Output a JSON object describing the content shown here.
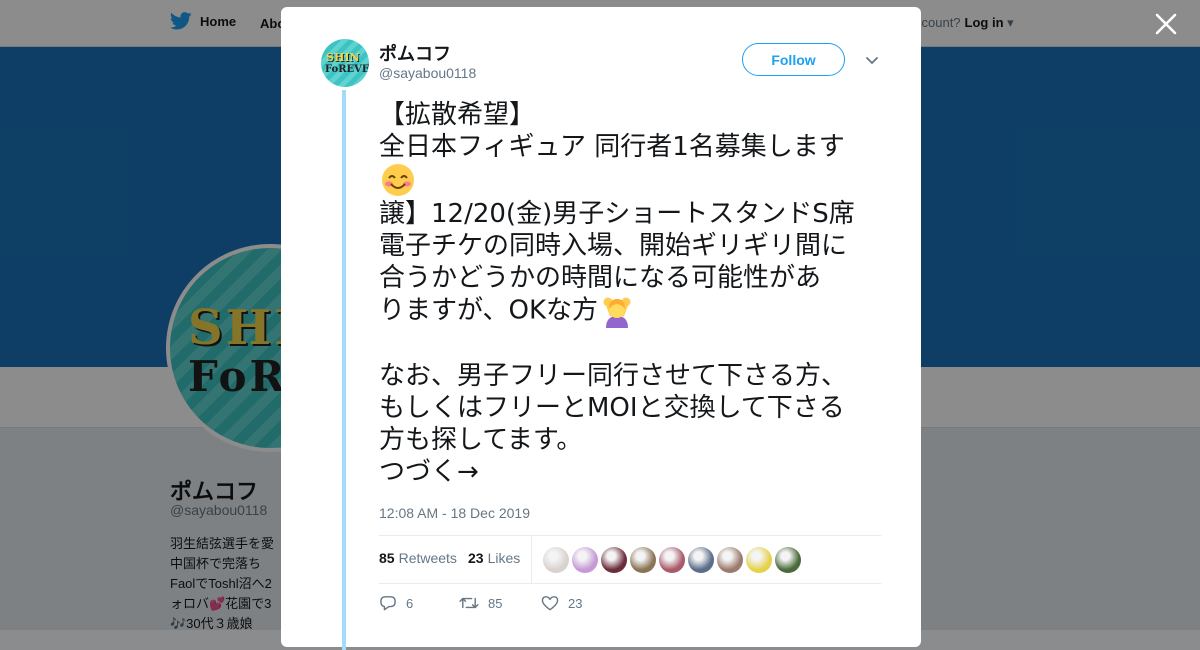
{
  "background": {
    "nav": {
      "home_label": "Home",
      "about_label": "Abo",
      "account_prompt": "ccount?",
      "login_label": "Log in"
    },
    "profile": {
      "name": "ポムコフ",
      "handle": "@sayabou0118",
      "bio_lines": [
        "羽生結弦選手を愛",
        "中国杯で完落ち",
        "FaolでToshl沼へ2",
        "ォロバ💕花園で3",
        "🎶30代３歳娘"
      ]
    }
  },
  "tweet": {
    "author_name": "ポムコフ",
    "author_handle": "@sayabou0118",
    "follow_label": "Follow",
    "text_lines": [
      "【拡散希望】",
      "全日本フィギュア 同行者1名募集します",
      "",
      "譲】12/20(金)男子ショートスタンドS席",
      "電子チケの同時入場、開始ギリギリ間に",
      "合うかどうかの時間になる可能性があ",
      "りますが、OKな方",
      "",
      "なお、男子フリー同行させて下さる方、",
      "もしくはフリーとMOIと交換して下さる",
      "方も探してます。",
      "つづく→"
    ],
    "timestamp": "12:08 AM - 18 Dec 2019",
    "retweets_count": "85",
    "retweets_label": "Retweets",
    "likes_count": "23",
    "likes_label": "Likes",
    "actions": {
      "reply_count": "6",
      "retweet_count": "85",
      "like_count": "23"
    },
    "liker_colors": [
      "#d9d2cf",
      "#c59ad6",
      "#6b2d3a",
      "#8b7355",
      "#a85a6a",
      "#5a6d8a",
      "#9b7b6e",
      "#e6d24a",
      "#4a6a3a"
    ]
  },
  "colors": {
    "accent": "#1da1f2",
    "thread_line": "#a3dcf9",
    "text_primary": "#14171a",
    "text_secondary": "#657786"
  },
  "icons": [
    "twitter-bird-icon",
    "close-icon",
    "chevron-down-icon",
    "reply-icon",
    "retweet-icon",
    "heart-icon",
    "smiling-face-emoji",
    "person-gesturing-ok-emoji"
  ]
}
